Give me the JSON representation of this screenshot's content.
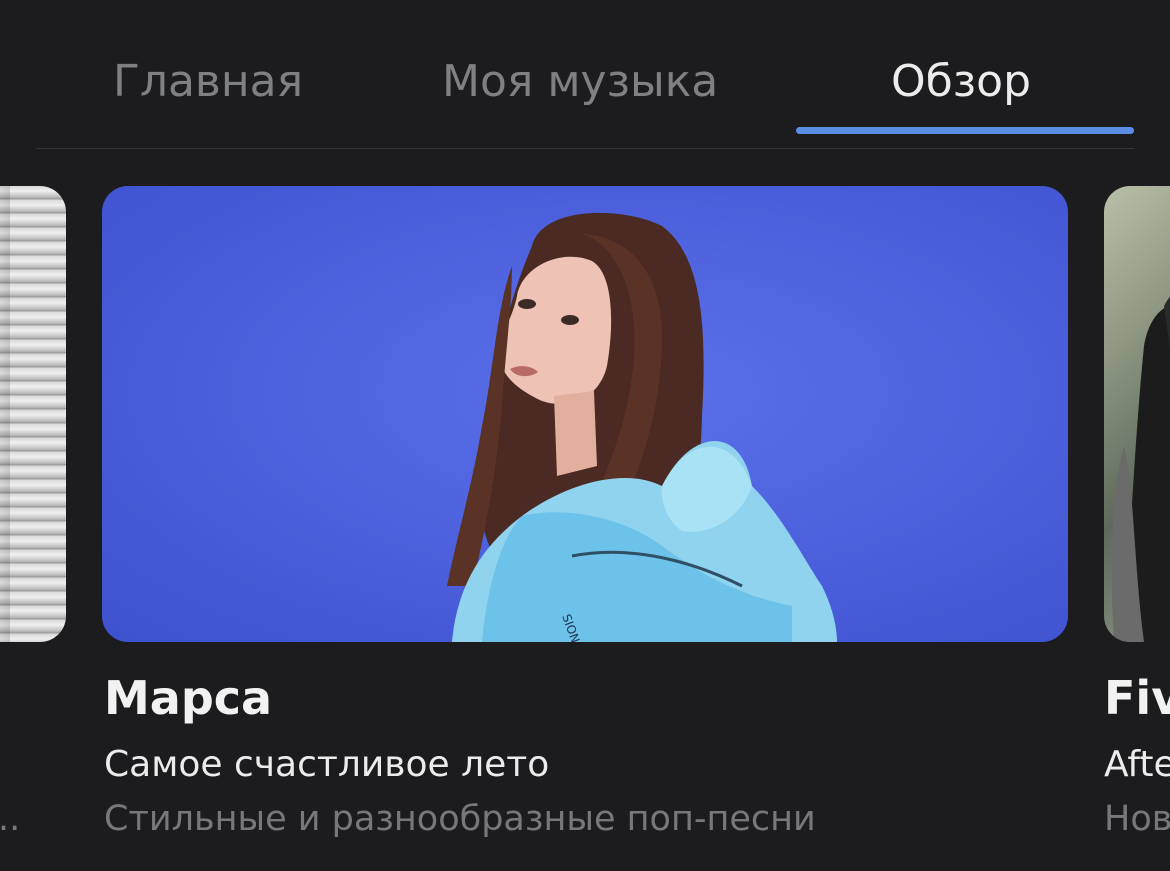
{
  "tabs": [
    {
      "label": "Главная",
      "active": false
    },
    {
      "label": "Моя музыка",
      "active": false
    },
    {
      "label": "Обзор",
      "active": true
    }
  ],
  "colors": {
    "background": "#1c1c1e",
    "accent": "#5b8fe6",
    "tab_inactive": "#7f8084",
    "text_primary": "#f2f2f2",
    "text_secondary": "#77787c",
    "main_card_background": "#4b5fdc"
  },
  "carousel": {
    "left_card": {
      "description": "н..."
    },
    "main_card": {
      "title": "Марса",
      "subtitle": "Самое счастливое лето",
      "description": "Стильные и разнообразные поп-песни",
      "jacket_print": "SION"
    },
    "right_card": {
      "title": "Fiv",
      "subtitle": "Afte",
      "description": "Нов"
    }
  }
}
